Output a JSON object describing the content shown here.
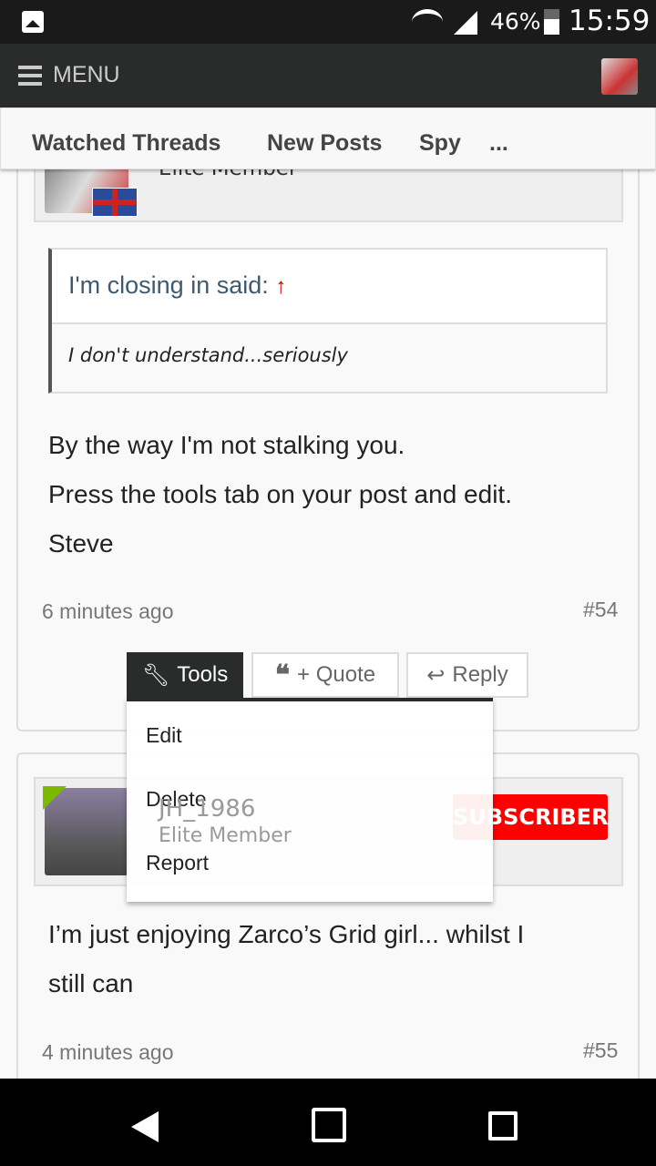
{
  "status_bar": {
    "battery": "46%",
    "time": "15:59"
  },
  "header": {
    "menu_label": "MENU"
  },
  "subnav": {
    "items": [
      "Watched Threads",
      "New Posts",
      "Spy",
      "..."
    ]
  },
  "post1": {
    "user_title": "Elite Member",
    "quote_author": "I'm closing in said:",
    "quote_arrow": "↑",
    "quote_text": "I don't understand...seriously",
    "lines": [
      "By the way I'm not stalking you.",
      "Press the tools tab on your post and edit.",
      "Steve"
    ],
    "time": "6 minutes ago",
    "number": "#54"
  },
  "actions": {
    "tools": "Tools",
    "quote": "+ Quote",
    "reply": "Reply"
  },
  "tools_menu": {
    "items": [
      "Edit",
      "Delete",
      "Report"
    ]
  },
  "post2": {
    "username": "JH_1986",
    "user_title": "Elite Member",
    "badge": "SUBSCRIBER",
    "lines": [
      "I’m just enjoying Zarco’s Grid girl... whilst I",
      "still can"
    ],
    "time": "4 minutes ago",
    "number": "#55"
  },
  "colors": {
    "header": "#2a2c2b",
    "badge": "#ff0000",
    "online": "#7cb800"
  }
}
